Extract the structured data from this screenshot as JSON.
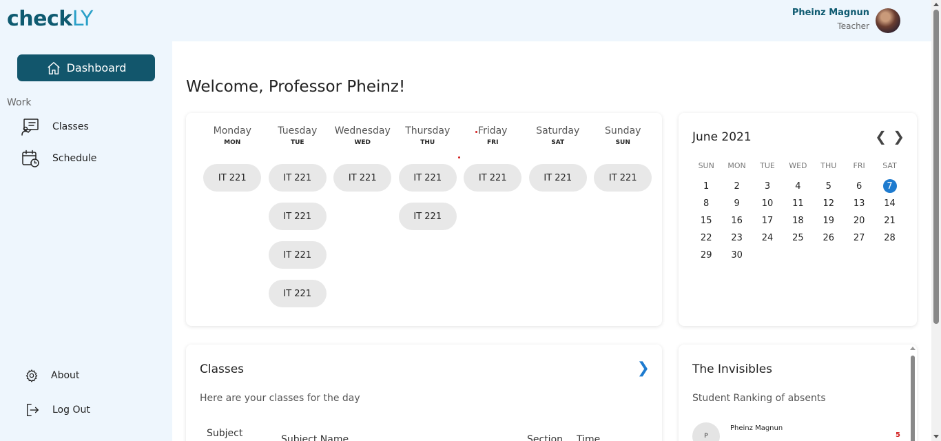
{
  "app": {
    "logo_main": "check",
    "logo_accent": "LY"
  },
  "user": {
    "name": "Pheinz Magnun",
    "role": "Teacher"
  },
  "sidebar": {
    "dashboard_label": "Dashboard",
    "section_label": "Work",
    "items": [
      {
        "label": "Classes",
        "icon": "classes-icon"
      },
      {
        "label": "Schedule",
        "icon": "calendar-clock-icon"
      }
    ],
    "about_label": "About",
    "logout_label": "Log Out"
  },
  "main": {
    "welcome": "Welcome, Professor Pheinz!",
    "week": [
      {
        "name": "Monday",
        "abbr": "MON",
        "classes": [
          "IT 221"
        ]
      },
      {
        "name": "Tuesday",
        "abbr": "TUE",
        "classes": [
          "IT 221",
          "IT 221",
          "IT 221",
          "IT 221"
        ]
      },
      {
        "name": "Wednesday",
        "abbr": "WED",
        "classes": [
          "IT 221"
        ]
      },
      {
        "name": "Thursday",
        "abbr": "THU",
        "classes": [
          "IT 221",
          "IT 221"
        ]
      },
      {
        "name": "Friday",
        "abbr": "FRI",
        "classes": [
          "IT 221"
        ]
      },
      {
        "name": "Saturday",
        "abbr": "SAT",
        "classes": [
          "IT 221"
        ]
      },
      {
        "name": "Sunday",
        "abbr": "SUN",
        "classes": [
          "IT 221"
        ]
      }
    ],
    "calendar": {
      "title": "June 2021",
      "prev": "❮",
      "next": "❯",
      "weekdays": [
        "SUN",
        "MON",
        "TUE",
        "WED",
        "THU",
        "FRI",
        "SAT"
      ],
      "leading_blanks": 0,
      "days": [
        1,
        2,
        3,
        4,
        5,
        6,
        7,
        8,
        9,
        10,
        11,
        12,
        13,
        14,
        15,
        16,
        17,
        18,
        19,
        20,
        21,
        22,
        23,
        24,
        25,
        26,
        27,
        28,
        29,
        30
      ],
      "selected": 7,
      "accent_color": "#1e7bcf"
    },
    "classes_card": {
      "title": "Classes",
      "subtitle": "Here are your classes for the day",
      "chevron": "❯",
      "columns": [
        "Subject",
        "Subject Name",
        "Section",
        "Time"
      ]
    },
    "invisibles": {
      "title": "The Invisibles",
      "subtitle": "Student Ranking of absents",
      "entries": [
        {
          "initial": "P",
          "name": "Pheinz Magnun",
          "count": "5"
        }
      ]
    }
  },
  "colors": {
    "brand": "#12566c",
    "brand_light": "#2aa0c8",
    "sidebar_bg": "#eef6fd",
    "alert": "#d32020"
  }
}
